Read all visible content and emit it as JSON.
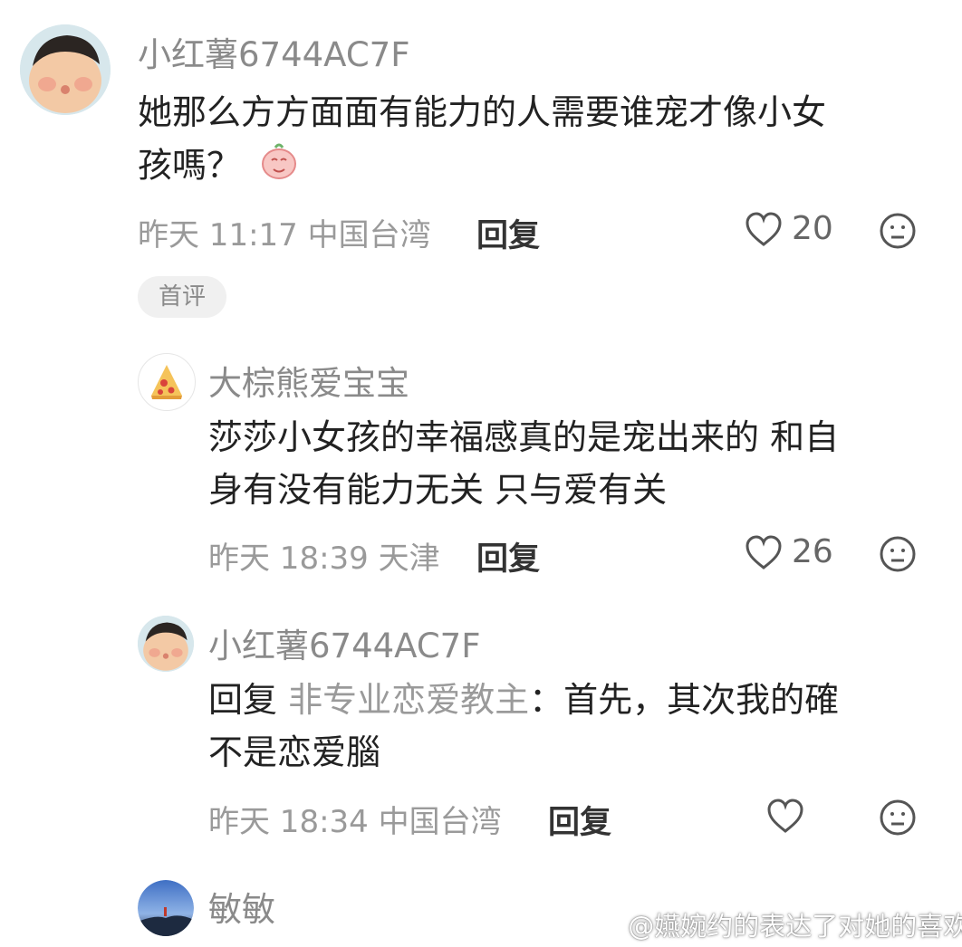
{
  "comments": [
    {
      "username": "小红薯6744AC7F",
      "text_line1": "她那么方方面面有能力的人需要谁宠才像小女",
      "text_line2": "孩嗎？",
      "meta": "昨天 11:17 中国台湾",
      "reply_label": "回复",
      "likes": "20",
      "badge": "首评"
    },
    {
      "username": "大棕熊爱宝宝",
      "text_line1": "莎莎小女孩的幸福感真的是宠出来的 和自",
      "text_line2": "身有没有能力无关 只与爱有关",
      "meta": "昨天 18:39 天津",
      "reply_label": "回复",
      "likes": "26"
    },
    {
      "username": "小红薯6744AC7F",
      "reply_prefix": "回复",
      "reply_to": "非专业恋爱教主",
      "text_line1": "：首先，其次我的確",
      "text_line2": "不是恋爱腦",
      "meta": "昨天 18:34 中国台湾",
      "reply_label": "回复"
    },
    {
      "username": "敏敏"
    }
  ],
  "watermark": "@嬿婉约的表达了对她的喜欢"
}
